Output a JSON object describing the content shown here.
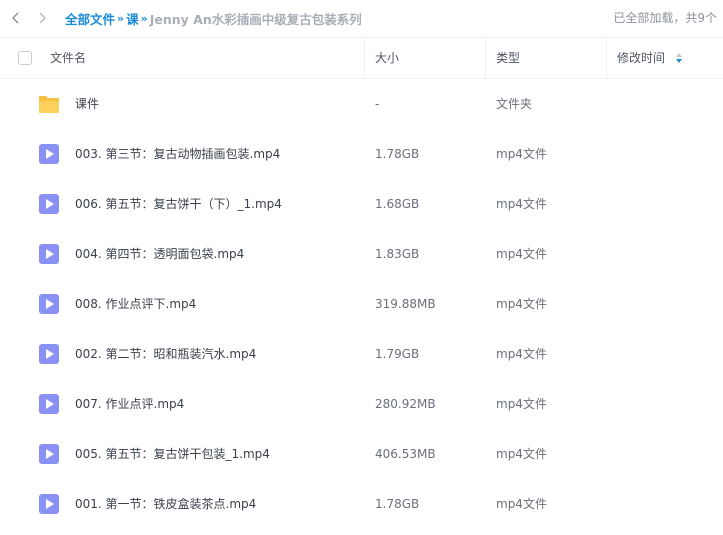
{
  "toolbar": {
    "breadcrumbs": [
      "全部文件",
      "课"
    ],
    "separator": "»",
    "current_folder": "Jenny An水彩插画中级复古包装系列",
    "load_status": "已全部加载，共9个"
  },
  "columns": {
    "name": "文件名",
    "size": "大小",
    "type": "类型",
    "modified": "修改时间"
  },
  "colors": {
    "accent": "#1b8bd6",
    "folder": "#f8c042",
    "video": "#8a91f4"
  },
  "files": [
    {
      "name": "课件",
      "size": "-",
      "type": "文件夹",
      "icon": "folder-icon"
    },
    {
      "name": "003. 第三节：复古动物插画包装.mp4",
      "size": "1.78GB",
      "type": "mp4文件",
      "icon": "video-file-icon"
    },
    {
      "name": "006. 第五节：复古饼干（下）_1.mp4",
      "size": "1.68GB",
      "type": "mp4文件",
      "icon": "video-file-icon"
    },
    {
      "name": "004. 第四节：透明面包袋.mp4",
      "size": "1.83GB",
      "type": "mp4文件",
      "icon": "video-file-icon"
    },
    {
      "name": "008. 作业点评下.mp4",
      "size": "319.88MB",
      "type": "mp4文件",
      "icon": "video-file-icon"
    },
    {
      "name": "002. 第二节：昭和瓶装汽水.mp4",
      "size": "1.79GB",
      "type": "mp4文件",
      "icon": "video-file-icon"
    },
    {
      "name": "007. 作业点评.mp4",
      "size": "280.92MB",
      "type": "mp4文件",
      "icon": "video-file-icon"
    },
    {
      "name": "005. 第五节：复古饼干包装_1.mp4",
      "size": "406.53MB",
      "type": "mp4文件",
      "icon": "video-file-icon"
    },
    {
      "name": "001. 第一节：铁皮盒装茶点.mp4",
      "size": "1.78GB",
      "type": "mp4文件",
      "icon": "video-file-icon"
    }
  ]
}
